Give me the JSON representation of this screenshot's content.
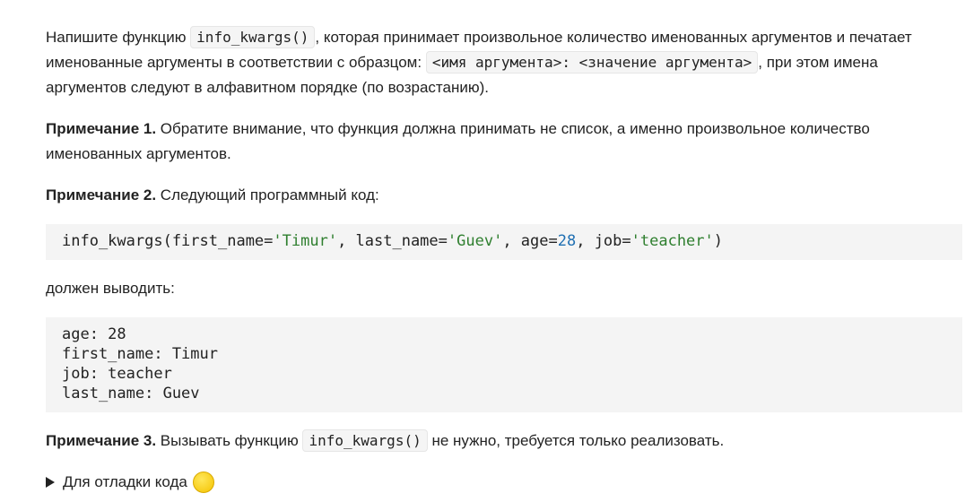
{
  "paragraph1": {
    "text_before": "Напишите функцию ",
    "code_function": "info_kwargs()",
    "text_middle": ", которая принимает произвольное количество именованных аргументов и печатает именованные аргументы в соответствии с образцом: ",
    "code_pattern": "<имя аргумента>: <значение аргумента>",
    "text_after": ", при этом имена аргументов следуют в алфавитном порядке (по возрастанию)."
  },
  "note1": {
    "label": "Примечание 1.",
    "text": " Обратите внимание, что функция должна принимать не список, а именно произвольное количество именованных аргументов."
  },
  "note2": {
    "label": "Примечание 2.",
    "text": " Следующий программный код:"
  },
  "code_call": {
    "func": "info_kwargs(first_name=",
    "s1": "'Timur'",
    "p2": ", last_name=",
    "s2": "'Guev'",
    "p3": ", age=",
    "n1": "28",
    "p4": ", job=",
    "s3": "'teacher'",
    "p5": ")"
  },
  "output_intro": "должен выводить:",
  "output_lines": {
    "line1": "age: 28",
    "line2": "first_name: Timur",
    "line3": "job: teacher",
    "line4": "last_name: Guev"
  },
  "note3": {
    "label": "Примечание 3.",
    "text_before": " Вызывать функцию ",
    "code_function": "info_kwargs()",
    "text_after": " не нужно, требуется только реализовать."
  },
  "details": {
    "summary": "Для отладки кода"
  }
}
